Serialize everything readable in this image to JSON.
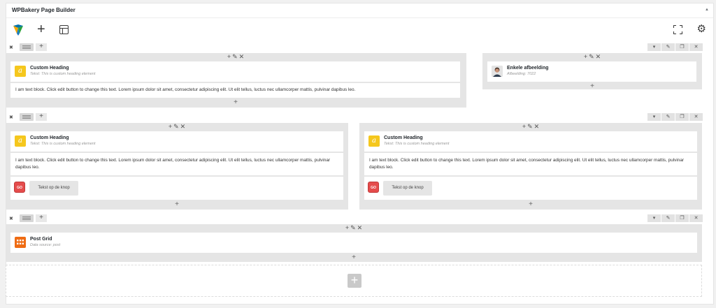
{
  "panel": {
    "title": "WPBakery Page Builder",
    "toggle_icon": "triangle-up-icon"
  },
  "navbar": {
    "add_label": "+",
    "gear_label": "⚙"
  },
  "common": {
    "plus": "+",
    "pencil": "✎",
    "close": "✕",
    "move": "✖",
    "dropdown": "▾",
    "clone": "❐"
  },
  "rows": [
    {
      "columns": [
        {
          "heading": {
            "title": "Custom Heading",
            "sub": "Tekst: This is custom heading element"
          },
          "text": "I am text block. Click edit button to change this text. Lorem ipsum dolor sit amet, consectetur adipiscing elit. Ut elit tellus, luctus nec ullamcorper mattis, pulvinar dapibus leo."
        },
        {
          "image": {
            "title": "Enkele afbeelding",
            "sub": "Afbeelding: 7022"
          }
        }
      ]
    },
    {
      "columns": [
        {
          "heading": {
            "title": "Custom Heading",
            "sub": "Tekst: This is custom heading element"
          },
          "text": "I am text block. Click edit button to change this text. Lorem ipsum dolor sit amet, consectetur adipiscing elit. Ut elit tellus, luctus nec ullamcorper mattis, pulvinar dapibus leo.",
          "button": {
            "icon_text": "GO",
            "label": "Tekst op de knop"
          }
        },
        {
          "heading": {
            "title": "Custom Heading",
            "sub": "Tekst: This is custom heading element"
          },
          "text": "I am text block. Click edit button to change this text. Lorem ipsum dolor sit amet, consectetur adipiscing elit. Ut elit tellus, luctus nec ullamcorper mattis, pulvinar dapibus leo.",
          "button": {
            "icon_text": "GO",
            "label": "Tekst op de knop"
          }
        }
      ]
    },
    {
      "columns": [
        {
          "grid": {
            "title": "Post Grid",
            "sub": "Data source: post"
          }
        }
      ]
    }
  ],
  "icons": {
    "logo": "wpbakery-logo-icon",
    "add": "plus-icon",
    "template": "template-icon",
    "fullscreen": "fullscreen-icon",
    "settings": "gear-icon"
  },
  "colors": {
    "heading_icon": "#f5c71d",
    "grid_icon": "#ef6c14",
    "button_icon": "#e54c4c",
    "column_bg": "#e5e5e5"
  }
}
